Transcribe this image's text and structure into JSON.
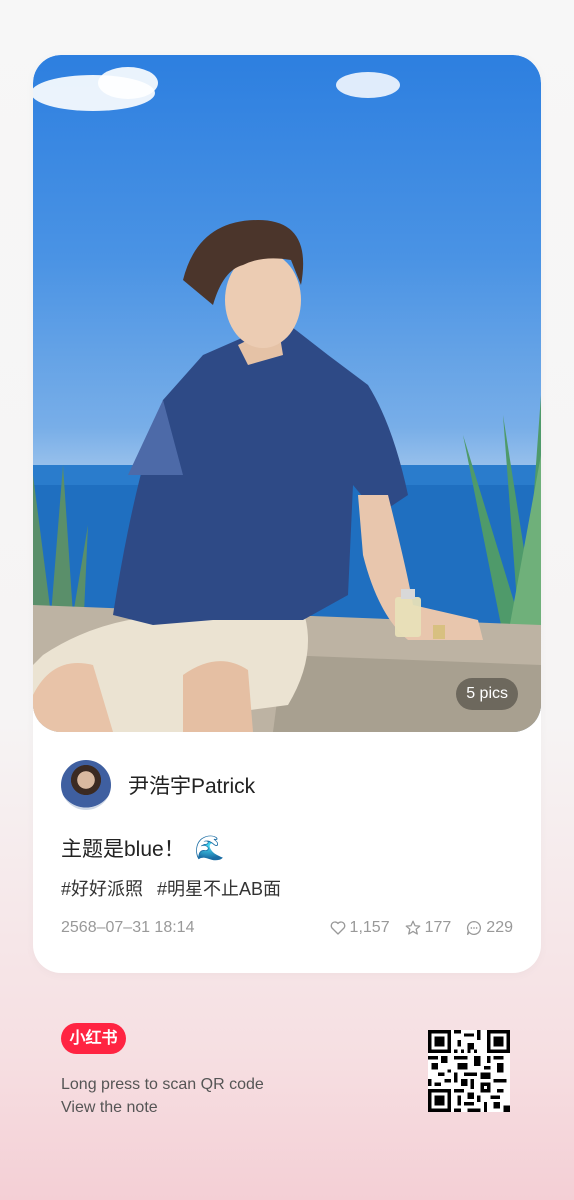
{
  "photo": {
    "badge": "5 pics"
  },
  "author": {
    "name": "尹浩宇Patrick"
  },
  "note": {
    "title": "主题是blue！",
    "title_emoji": "🌊",
    "tags": [
      "#好好派照",
      "#明星不止AB面"
    ],
    "date": "2568–07–31 18:14",
    "likes": "1,157",
    "collects": "177",
    "comments": "229"
  },
  "footer": {
    "logo_text": "小红书",
    "line1": "Long press to scan QR code",
    "line2": "View the note"
  },
  "colors": {
    "brand": "#ff2442",
    "meta": "#999999"
  },
  "icons": [
    "heart-icon",
    "star-icon",
    "comment-icon",
    "qr-code"
  ]
}
